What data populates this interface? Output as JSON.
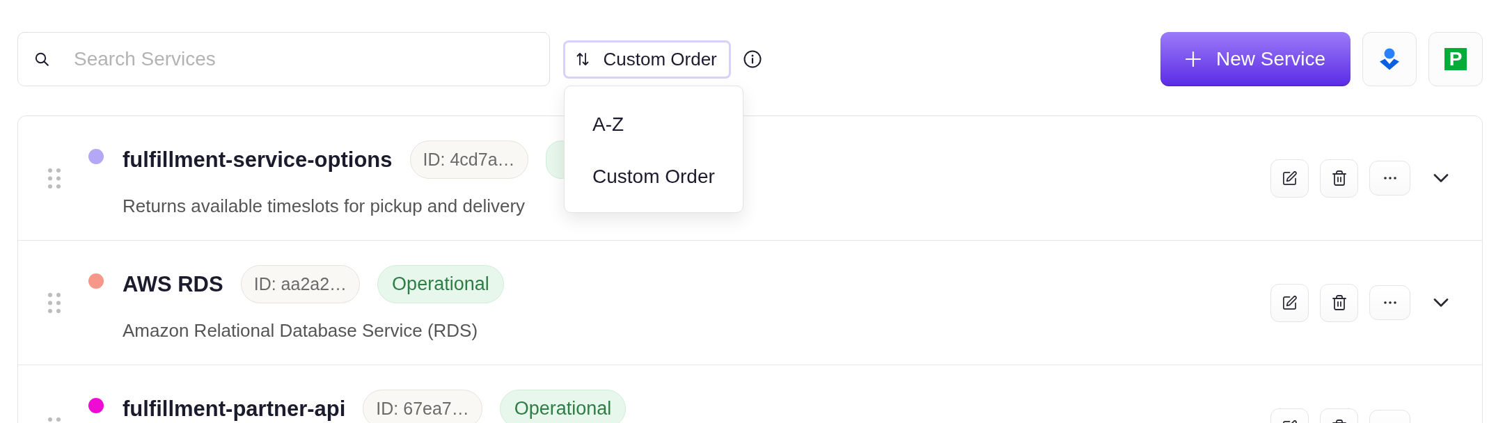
{
  "search": {
    "placeholder": "Search Services"
  },
  "sort": {
    "label": "Custom Order",
    "menu_open": true,
    "menu": [
      "A-Z",
      "Custom Order"
    ]
  },
  "new_service_button": {
    "label": "New Service"
  },
  "integrations": [
    {
      "kind": "figure"
    },
    {
      "kind": "letter",
      "text": "P"
    }
  ],
  "services": [
    {
      "name": "fulfillment-service-options",
      "color": "#b4a8f6",
      "id_badge": "ID: 4cd7a…",
      "description": "Returns available timeslots for pickup and delivery"
    },
    {
      "name": "AWS RDS",
      "color": "#f6978a",
      "id_badge": "ID: aa2a2…",
      "status": "Operational",
      "description": "Amazon Relational Database Service (RDS)"
    },
    {
      "name": "fulfillment-partner-api",
      "color": "#ee0bd4",
      "id_badge": "ID: 67ea7…",
      "status": "Operational"
    }
  ]
}
